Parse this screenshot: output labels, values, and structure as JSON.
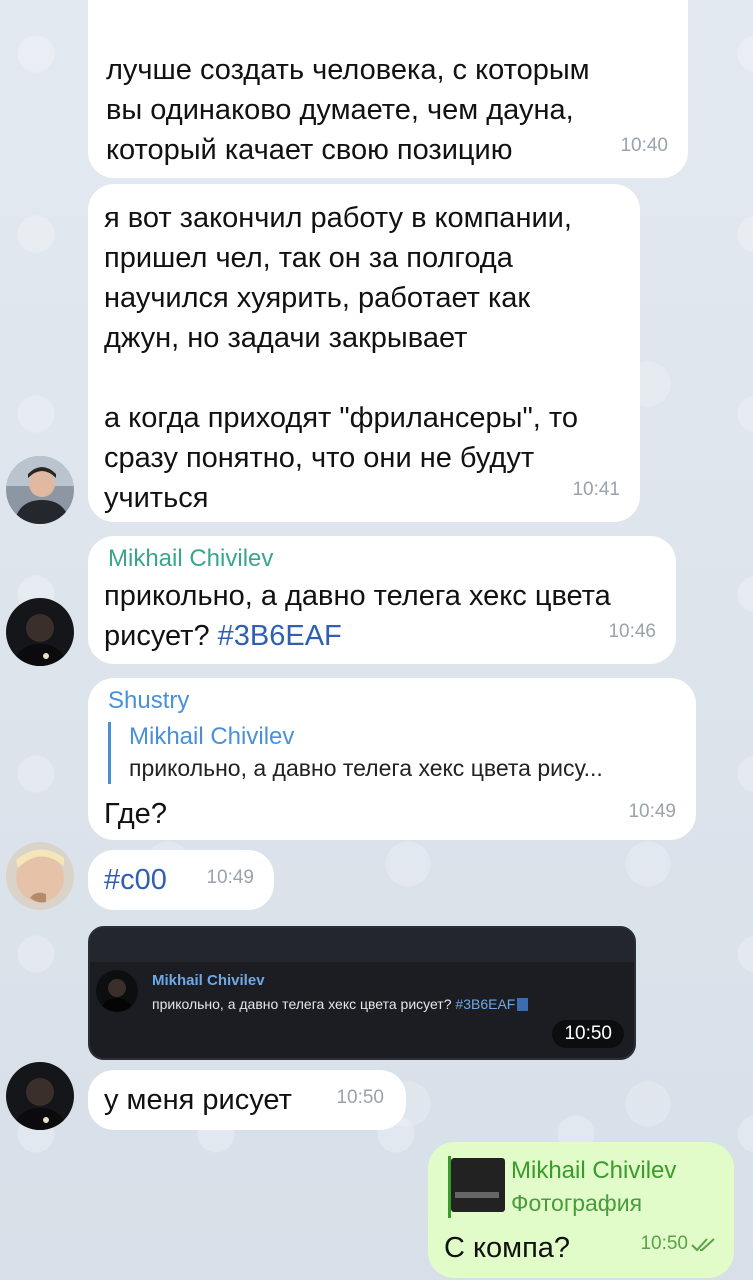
{
  "messages": {
    "m1": {
      "text": "лучше создать человека, с которым\nвы одинаково думаете, чем дауна,\nкоторый качает свою позицию",
      "time": "10:40"
    },
    "m2": {
      "text": "я вот закончил работу в компании,\nпришел чел, так он за полгода\nнаучился хуярить, работает как\nджун, но задачи закрывает\n\nа когда приходят \"фрилансеры\", то\nсразу понятно, что они не будут\nучиться",
      "time": "10:41"
    },
    "m3": {
      "sender": "Mikhail Chivilev",
      "text": "прикольно, а давно телега хекс цвета\nрисует? ",
      "hashtag": "#3B6EAF",
      "time": "10:46"
    },
    "m4": {
      "sender": "Shustry",
      "reply_sender": "Mikhail Chivilev",
      "reply_text": "прикольно, а давно телега хекс цвета рису...",
      "text": "Где?",
      "time": "10:49"
    },
    "m5": {
      "hashtag": "#c00",
      "time": "10:49"
    },
    "m6": {
      "shot_sender": "Mikhail Chivilev",
      "shot_text": "прикольно, а давно телега хекс цвета рисует? ",
      "shot_hashtag": "#3B6EAF",
      "time": "10:50"
    },
    "m7": {
      "text": "у меня рисует",
      "time": "10:50"
    },
    "m8": {
      "reply_sender": "Mikhail Chivilev",
      "reply_text": "Фотография",
      "text": "С компа?",
      "time": "10:50"
    }
  },
  "colors": {
    "hashtag_blue": "#3B6EAF",
    "hashtag_red": "#cc0000",
    "sender_green": "#3aa58d",
    "sender_blue": "#4a90d9",
    "outgoing_green": "#3a9b2b"
  }
}
